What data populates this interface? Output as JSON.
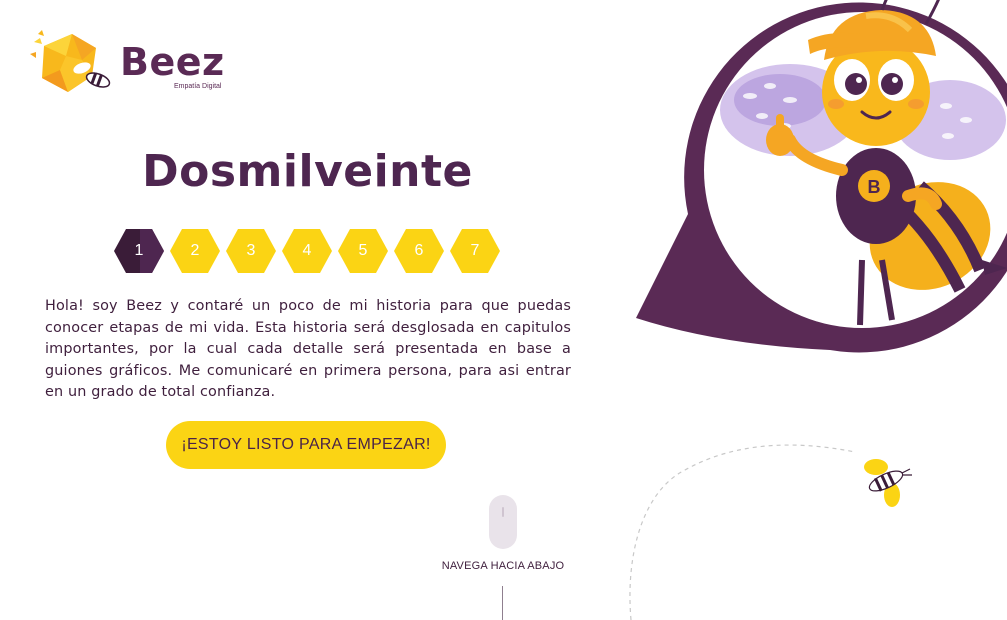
{
  "brand": {
    "name": "Beez",
    "tagline": "Empatía Digital"
  },
  "page": {
    "title": "Dosmilveinte"
  },
  "steps": [
    {
      "label": "1",
      "active": true
    },
    {
      "label": "2",
      "active": false
    },
    {
      "label": "3",
      "active": false
    },
    {
      "label": "4",
      "active": false
    },
    {
      "label": "5",
      "active": false
    },
    {
      "label": "6",
      "active": false
    },
    {
      "label": "7",
      "active": false
    }
  ],
  "intro": {
    "text": "Hola! soy Beez y contaré un poco de mi historia para que puedas conocer etapas de mi vida. Esta historia será desglosada en capitulos importantes, por la cual cada detalle será presentada en base a guiones gráficos. Me comunicaré en primera persona, para asi entrar en un grado de total confianza."
  },
  "cta": {
    "label": "¡ESTOY LISTO PARA EMPEZAR!"
  },
  "scroll_hint": {
    "label": "NAVEGA HACIA ABAJO"
  },
  "colors": {
    "plum": "#5a2a55",
    "plum_dark": "#3a1c38",
    "yellow": "#fbd414",
    "orange": "#f5a623",
    "lavender": "#c9b6e4"
  },
  "icons": {
    "logo": "bee-hexagon-logo",
    "mouse": "mouse-scroll-icon",
    "mascot": "bee-mascot-illustration",
    "small_bee": "flying-bee-icon"
  }
}
